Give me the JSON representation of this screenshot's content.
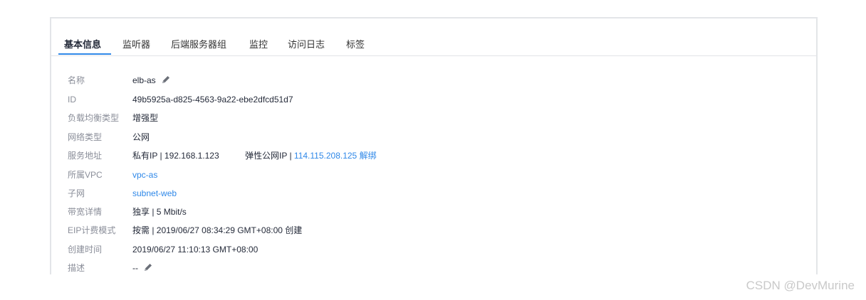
{
  "tabs": [
    {
      "label": "基本信息",
      "active": true
    },
    {
      "label": "监听器",
      "active": false
    },
    {
      "label": "后端服务器组",
      "active": false
    },
    {
      "label": "监控",
      "active": false
    },
    {
      "label": "访问日志",
      "active": false
    },
    {
      "label": "标签",
      "active": false
    }
  ],
  "info": {
    "name": {
      "label": "名称",
      "value": "elb-as",
      "icon": "pencil-icon"
    },
    "id": {
      "label": "ID",
      "value": "49b5925a-d825-4563-9a22-ebe2dfcd51d7"
    },
    "lb_type": {
      "label": "负载均衡类型",
      "value": "增强型"
    },
    "network_type": {
      "label": "网络类型",
      "value": "公网"
    },
    "service_address": {
      "label": "服务地址",
      "private_prefix": "私有IP | 192.168.1.123",
      "eip_prefix": "弹性公网IP | ",
      "eip_value": "114.115.208.125",
      "unbind_label": "解绑"
    },
    "vpc": {
      "label": "所属VPC",
      "value": "vpc-as"
    },
    "subnet": {
      "label": "子网",
      "value": "subnet-web"
    },
    "bandwidth": {
      "label": "带宽详情",
      "value": "独享 | 5 Mbit/s"
    },
    "eip_billing": {
      "label": "EIP计费模式",
      "value": "按需 | 2019/06/27 08:34:29 GMT+08:00 创建"
    },
    "created_time": {
      "label": "创建时间",
      "value": "2019/06/27 11:10:13 GMT+08:00"
    },
    "description": {
      "label": "描述",
      "value": "--",
      "icon": "pencil-icon"
    }
  },
  "watermark": "CSDN @DevMurine",
  "colors": {
    "accent": "#2f88e8",
    "label": "#8a8e99",
    "text": "#252b3a",
    "border": "#e3e5e8"
  }
}
